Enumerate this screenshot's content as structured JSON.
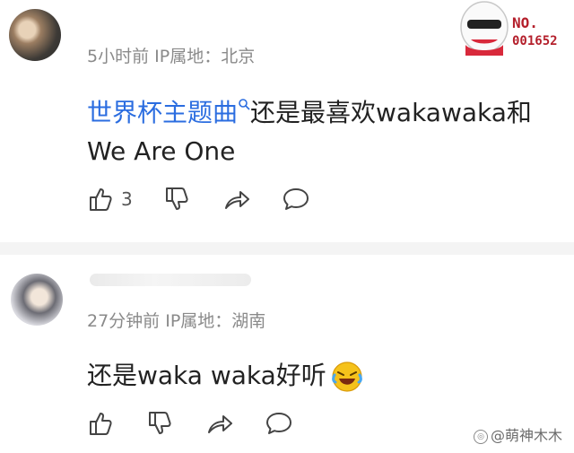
{
  "comments": [
    {
      "meta": "5小时前  IP属地：北京",
      "link_text": "世界杯主题曲",
      "text_line1_rest": "还是最喜欢wakawaka和",
      "text_line2": "We Are One",
      "like_count": "3"
    },
    {
      "meta": "27分钟前  IP属地：湖南",
      "text": "还是waka waka好听"
    }
  ],
  "stamp": {
    "no": "NO.",
    "number": "001652"
  },
  "watermark": "@萌神木木",
  "icons": [
    "thumbs-up-icon",
    "thumbs-down-icon",
    "share-icon",
    "reply-icon",
    "search-icon",
    "laughing-emoji-icon"
  ],
  "colors": {
    "link": "#2b6de0",
    "meta": "#8a8a8a",
    "stamp": "#b41f2b",
    "divider": "#f4f4f4"
  }
}
